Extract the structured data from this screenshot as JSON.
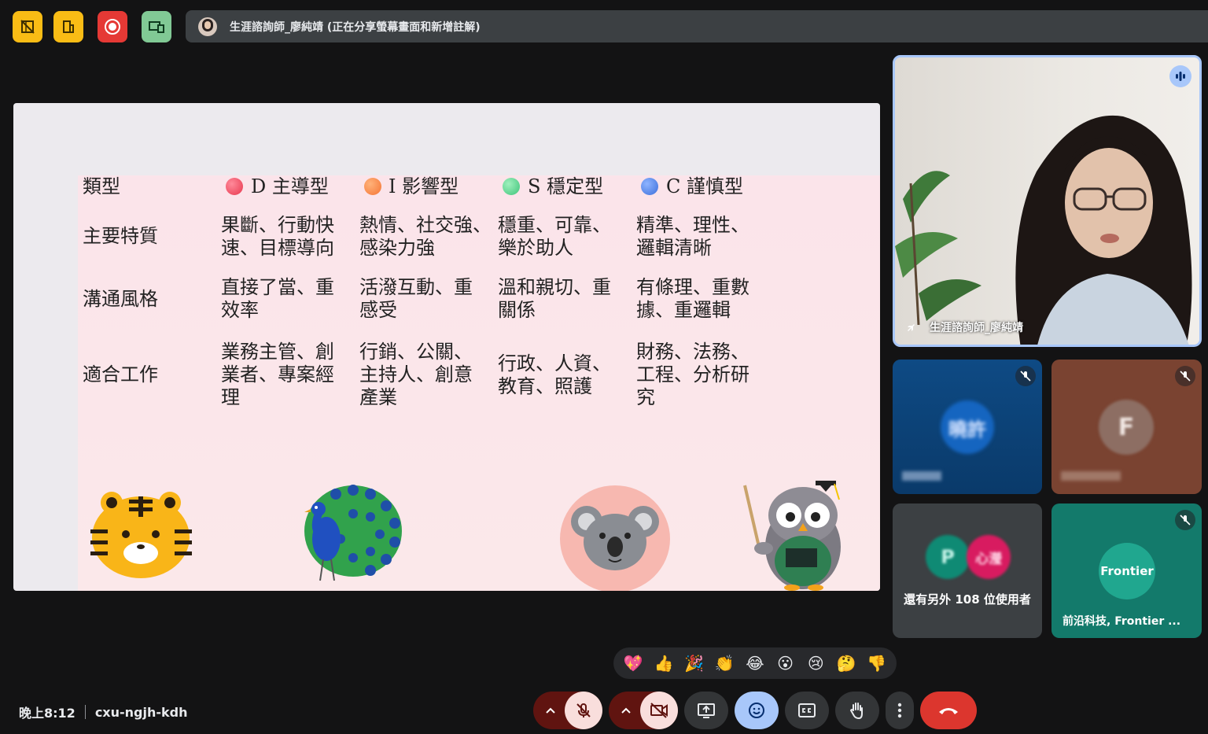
{
  "top_icons": [
    {
      "name": "no-grid-icon",
      "color": "#f9bc15"
    },
    {
      "name": "building-icon",
      "color": "#f9bc15"
    },
    {
      "name": "record-icon",
      "color": "#e53935"
    },
    {
      "name": "companion-icon",
      "color": "#81c995"
    }
  ],
  "presenter_banner": "生涯諮詢師_廖純靖 (正在分享螢幕畫面和新增註解)",
  "slide": {
    "header_label": "類型",
    "types": [
      {
        "label": "D 主導型",
        "color": "#e8374e"
      },
      {
        "label": "I 影響型",
        "color": "#f57534"
      },
      {
        "label": "S 穩定型",
        "color": "#3ec47a"
      },
      {
        "label": "C 謹慎型",
        "color": "#3b6fdb"
      }
    ],
    "rows": [
      {
        "label": "主要特質",
        "cells": [
          "果斷、行動快\n速、目標導向",
          "熱情、社交強、\n感染力強",
          "穩重、可靠、\n樂於助人",
          "精準、理性、\n邏輯清晰"
        ]
      },
      {
        "label": "溝通風格",
        "cells": [
          "直接了當、重\n效率",
          "活潑互動、重\n感受",
          "溫和親切、重\n關係",
          "有條理、重數\n據、重邏輯"
        ]
      },
      {
        "label": "適合工作",
        "cells": [
          "業務主管、創\n業者、專案經\n理",
          "行銷、公關、\n主持人、創意\n產業",
          "行政、人資、\n教育、照護",
          "財務、法務、\n工程、分析研\n究"
        ]
      }
    ]
  },
  "speaker_tile": {
    "name": "生涯諮詢師_廖純靖"
  },
  "other_count_label": "還有另外 108 位使用者",
  "frontier_tile": {
    "logo": "Frontier",
    "name": "前沿科技, Frontier ..."
  },
  "blurred_tiles": [
    {
      "initials": "曉許",
      "color": "#1565c0"
    },
    {
      "initials": "F",
      "color": "#8d6e63"
    }
  ],
  "group_avatars": [
    {
      "initials": "P",
      "color": "#0f8a74"
    },
    {
      "initials": "心瀅",
      "color": "#d81b60"
    }
  ],
  "reactions": [
    "💖",
    "👍",
    "🎉",
    "👏",
    "😂",
    "😮",
    "😢",
    "🤔",
    "👎"
  ],
  "meeting": {
    "time": "晚上8:12",
    "code": "cxu-ngjh-kdh"
  },
  "colors": {
    "end_call": "#dc362e",
    "mic_off_bg": "#f9dedc",
    "mic_off_chip": "#601410",
    "reactions_active": "#a8c7fa"
  }
}
